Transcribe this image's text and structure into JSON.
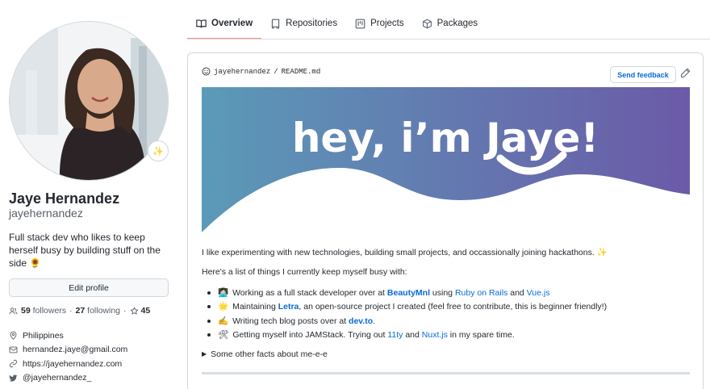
{
  "tabs": [
    {
      "label": "Overview",
      "icon": "book-icon",
      "active": true
    },
    {
      "label": "Repositories",
      "icon": "repo-icon",
      "active": false
    },
    {
      "label": "Projects",
      "icon": "project-icon",
      "active": false
    },
    {
      "label": "Packages",
      "icon": "package-icon",
      "active": false
    }
  ],
  "profile": {
    "name": "Jaye Hernandez",
    "login": "jayehernandez",
    "bio": "Full stack dev who likes to keep herself busy by building stuff on the side",
    "bio_emoji": "🌻",
    "status_emoji": "✨",
    "edit_label": "Edit profile",
    "followers_count": "59",
    "followers_label": "followers",
    "separator": "·",
    "following_count": "27",
    "following_label": "following",
    "stars_count": "45",
    "location": "Philippines",
    "email": "hernandez.jaye@gmail.com",
    "website": "https://jayehernandez.com",
    "twitter": "@jayehernandez_"
  },
  "readme": {
    "path_user": "jayehernandez",
    "path_sep": "/",
    "path_file": "README.md",
    "feedback_label": "Send feedback",
    "banner_text": "hey, i’m Jaye!",
    "banner_colors": {
      "left": "#5b9ab8",
      "right": "#6b5aa8"
    },
    "intro": "I like experimenting with new technologies, building small projects, and occassionally joining hackathons.",
    "intro_emoji": "✨",
    "list_intro": "Here's a list of things I currently keep myself busy with:",
    "items": [
      {
        "emoji": "👩🏻‍💻",
        "parts": [
          {
            "t": "Working as a full stack developer over at ",
            "s": "text"
          },
          {
            "t": "BeautyMnl",
            "s": "link-b"
          },
          {
            "t": " using ",
            "s": "text"
          },
          {
            "t": "Ruby on Rails",
            "s": "link"
          },
          {
            "t": " and ",
            "s": "text"
          },
          {
            "t": "Vue.js",
            "s": "link"
          }
        ]
      },
      {
        "emoji": "🌟",
        "parts": [
          {
            "t": "Maintaining ",
            "s": "text"
          },
          {
            "t": "Letra",
            "s": "link-b"
          },
          {
            "t": ", an open-source project I created (feel free to contribute, this is beginner friendly!)",
            "s": "text"
          }
        ]
      },
      {
        "emoji": "✍️",
        "parts": [
          {
            "t": "Writing tech blog posts over at ",
            "s": "text"
          },
          {
            "t": "dev.to",
            "s": "link-b"
          },
          {
            "t": ".",
            "s": "text"
          }
        ]
      },
      {
        "emoji": "🛠",
        "parts": [
          {
            "t": "Getting myself into JAMStack. Trying out ",
            "s": "text"
          },
          {
            "t": "11ty",
            "s": "link"
          },
          {
            "t": " and ",
            "s": "text"
          },
          {
            "t": "Nuxt.js",
            "s": "link"
          },
          {
            "t": " in my spare time.",
            "s": "text"
          }
        ]
      }
    ],
    "details_label": "Some other facts about me-e-e",
    "details_marker": "▶"
  }
}
